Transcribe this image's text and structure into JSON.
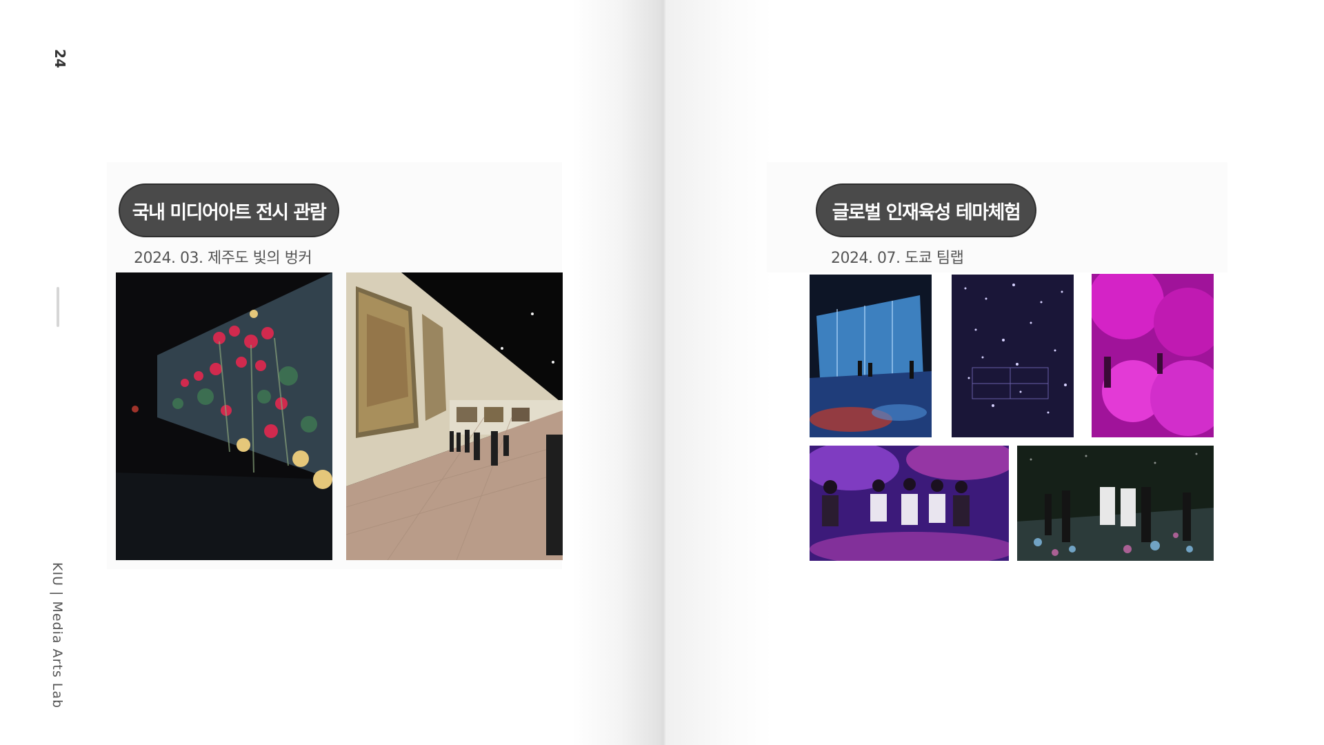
{
  "page_number": "24",
  "lab_name": "KIU | Media Arts Lab",
  "left": {
    "heading": "국내 미디어아트 전시 관람",
    "caption": "2024. 03. 제주도 빛의 벙커",
    "photos": [
      "flower-projection-photo",
      "gallery-corridor-photo"
    ]
  },
  "right": {
    "heading": "글로벌 인재육성 테마체험",
    "caption": "2024. 07. 도쿄 팀랩",
    "photos": [
      "digital-waterfall-photo",
      "infinity-light-room-photo",
      "magenta-balloon-photo",
      "student-group-photo",
      "light-floor-crowd-photo"
    ]
  }
}
